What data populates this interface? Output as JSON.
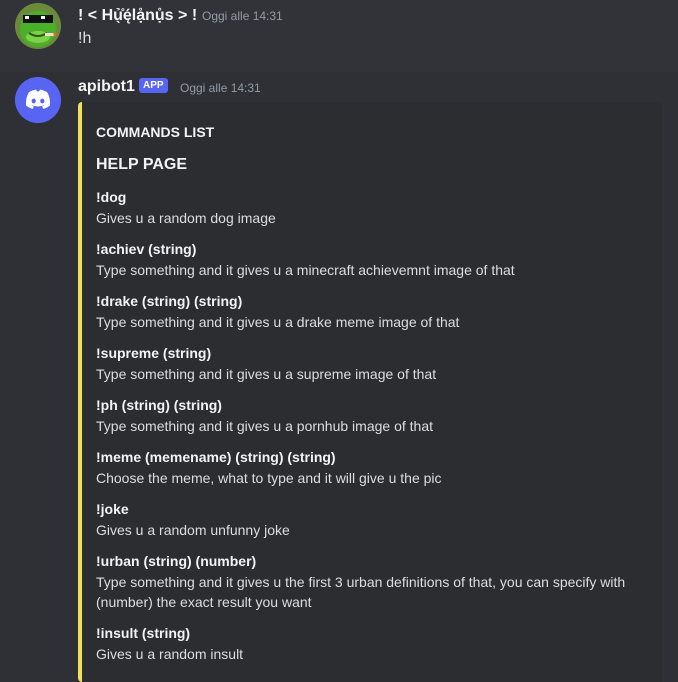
{
  "colors": {
    "background": "#313338",
    "embed_bg": "#2b2d31",
    "embed_accent": "#f1e05a",
    "blurple": "#5865f2"
  },
  "messages": [
    {
      "username": "! < Hủ̖̊ę́lạ̊nụ̊s > !",
      "timestamp": "Oggi alle 14:31",
      "content": "!h",
      "avatar_icon": "green-frog-sunglasses-avatar"
    },
    {
      "username": "apibot1",
      "badge": "APP",
      "timestamp": "Oggi alle 14:31",
      "avatar_icon": "discord-logo-icon",
      "embed": {
        "author": "COMMANDS LIST",
        "title": "HELP PAGE",
        "fields": [
          {
            "name": "!dog",
            "value": "Gives u a random dog image"
          },
          {
            "name": "!achiev (string)",
            "value": "Type something and it gives u a minecraft achievemnt image of that"
          },
          {
            "name": "!drake (string) (string)",
            "value": "Type something and it gives u a drake meme image of that"
          },
          {
            "name": "!supreme (string)",
            "value": "Type something and it gives u a supreme image of that"
          },
          {
            "name": "!ph (string) (string)",
            "value": "Type something and it gives u a pornhub image of that"
          },
          {
            "name": "!meme (memename) (string) (string)",
            "value": "Choose the meme, what to type and it will give u the pic"
          },
          {
            "name": "!joke",
            "value": "Gives u a random unfunny joke"
          },
          {
            "name": "!urban (string) (number)",
            "value": "Type something and it gives u the first 3 urban definitions of that, you can specify with (number) the exact result you want"
          },
          {
            "name": "!insult (string)",
            "value": "Gives u a random insult"
          }
        ]
      }
    }
  ]
}
